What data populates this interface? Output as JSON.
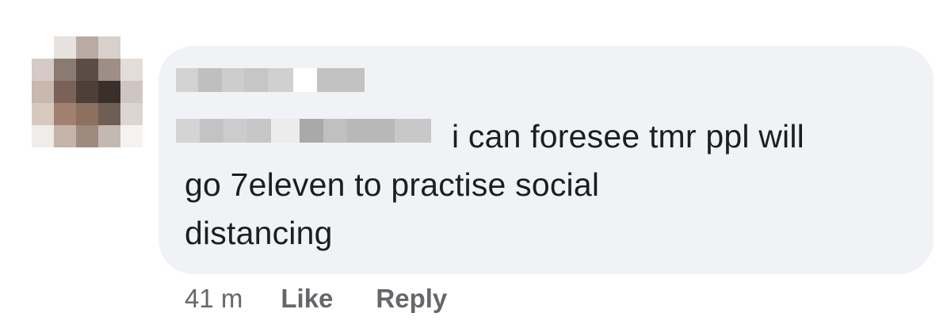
{
  "avatar": {
    "pixels": [
      [
        "#ffffff",
        "#e6e2e0",
        "#b9aaa3",
        "#d8d0cc",
        "#ffffff"
      ],
      [
        "#d6cac6",
        "#8a7a72",
        "#5c4c46",
        "#9e8e86",
        "#e3ddda"
      ],
      [
        "#c9b8ae",
        "#7a6258",
        "#4e3e38",
        "#3b2f2c",
        "#cfc6c2"
      ],
      [
        "#d8c9c0",
        "#a08070",
        "#8c7060",
        "#6e5e56",
        "#dcd6d3"
      ],
      [
        "#f0ece9",
        "#c6b4aa",
        "#9e8a7e",
        "#c4b8b2",
        "#f5f3f2"
      ]
    ]
  },
  "comment": {
    "name_redaction_blocks": [
      "#d2d2d2",
      "#bfbfbf",
      "#cdcdcd",
      "#c6c6c6",
      "#d0d0d0",
      "#ffffff",
      "#c2c2c2"
    ],
    "mention_redaction_blocks": [
      "#d4d4d4",
      "#c3c3c3",
      "#cccccc",
      "#c6c6c6",
      "#ececec",
      "#a9a9a9",
      "#c0c0c0",
      "#b8b8b8",
      "#c8c8c8"
    ],
    "text_line1": "i can foresee tmr ppl will",
    "text_line2": "go 7eleven to practise social",
    "text_line3": "distancing"
  },
  "actions": {
    "time": "41 m",
    "like_label": "Like",
    "reply_label": "Reply"
  }
}
